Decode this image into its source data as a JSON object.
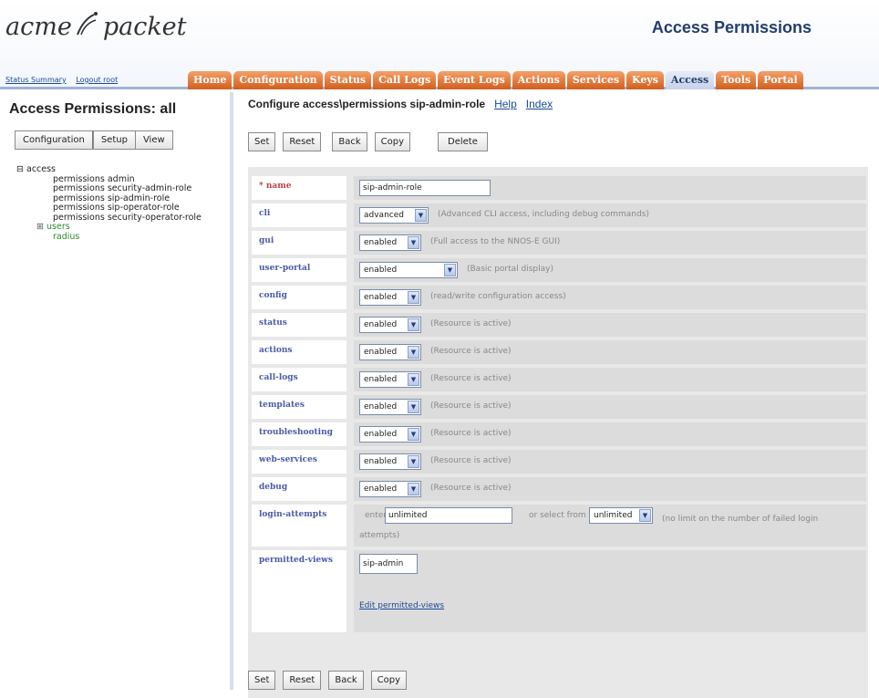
{
  "header": {
    "logo_left": "acme",
    "logo_right": "packet",
    "links": [
      "Status Summary",
      "Logout root"
    ],
    "page_heading": "Access Permissions"
  },
  "tabs": [
    {
      "label": "Home",
      "active": false
    },
    {
      "label": "Configuration",
      "active": false
    },
    {
      "label": "Status",
      "active": false
    },
    {
      "label": "Call Logs",
      "active": false
    },
    {
      "label": "Event Logs",
      "active": false
    },
    {
      "label": "Actions",
      "active": false
    },
    {
      "label": "Services",
      "active": false
    },
    {
      "label": "Keys",
      "active": false
    },
    {
      "label": "Access",
      "active": true
    },
    {
      "label": "Tools",
      "active": false
    },
    {
      "label": "Portal",
      "active": false
    }
  ],
  "sidebar": {
    "title": "Access Permissions: all",
    "buttons": [
      "Configuration",
      "Setup",
      "View"
    ],
    "tree": {
      "root": "access",
      "items": [
        "permissions admin",
        "permissions security-admin-role",
        "permissions sip-admin-role",
        "permissions sip-operator-role",
        "permissions security-operator-role"
      ],
      "users": "users",
      "radius": "radius",
      "expand_glyph": "⊞",
      "collapse_glyph": "⊟"
    }
  },
  "content": {
    "title": "Configure access\\permissions sip-admin-role",
    "help": "Help",
    "index": "Index",
    "top_buttons": [
      "Set",
      "Reset",
      "Back",
      "Copy",
      "Delete"
    ],
    "bottom_buttons": [
      "Set",
      "Reset",
      "Back",
      "Copy"
    ],
    "fields": {
      "name": {
        "label": "* name",
        "value": "sip-admin-role"
      },
      "cli": {
        "label": "cli",
        "value": "advanced",
        "hint": "(Advanced CLI access, including debug commands)"
      },
      "gui": {
        "label": "gui",
        "value": "enabled",
        "hint": "(Full access to the NNOS-E GUI)"
      },
      "user_portal": {
        "label": "user-portal",
        "value": "enabled",
        "hint": "(Basic portal display)"
      },
      "config": {
        "label": "config",
        "value": "enabled",
        "hint": "(read/write configuration access)"
      },
      "status": {
        "label": "status",
        "value": "enabled",
        "hint": "(Resource is active)"
      },
      "actions": {
        "label": "actions",
        "value": "enabled",
        "hint": "(Resource is active)"
      },
      "call_logs": {
        "label": "call-logs",
        "value": "enabled",
        "hint": "(Resource is active)"
      },
      "templates": {
        "label": "templates",
        "value": "enabled",
        "hint": "(Resource is active)"
      },
      "troubleshooting": {
        "label": "troubleshooting",
        "value": "enabled",
        "hint": "(Resource is active)"
      },
      "web_services": {
        "label": "web-services",
        "value": "enabled",
        "hint": "(Resource is active)"
      },
      "debug": {
        "label": "debug",
        "value": "enabled",
        "hint": "(Resource is active)"
      },
      "login_attempts": {
        "label": "login-attempts",
        "enter": "enter",
        "value": "unlimited",
        "or_select": "or select from",
        "select_value": "unlimited",
        "hint": "(no limit on the number of failed login attempts)"
      },
      "permitted_views": {
        "label": "permitted-views",
        "value": "sip-admin",
        "edit_link": "Edit permitted-views"
      }
    }
  }
}
